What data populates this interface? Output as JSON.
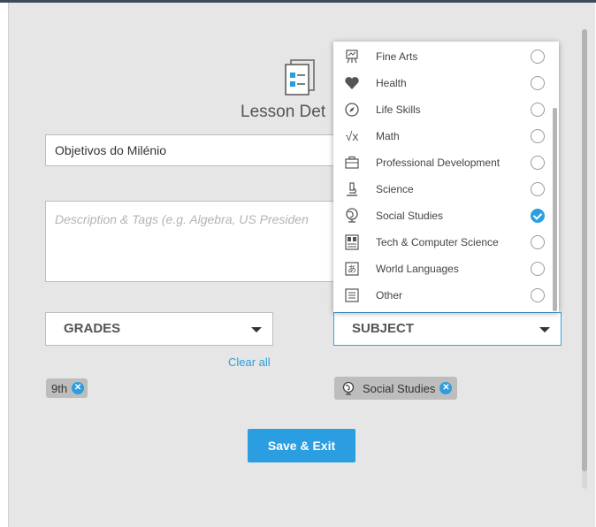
{
  "header": {
    "title": "Lesson Det"
  },
  "form": {
    "title_value": "Objetivos do Milénio",
    "description_placeholder": "Description & Tags (e.g. Algebra, US Presiden"
  },
  "grades": {
    "label": "GRADES",
    "clear_all": "Clear all",
    "selected": [
      "9th"
    ]
  },
  "subject": {
    "label": "SUBJECT",
    "selected_chip": "Social Studies",
    "options": [
      {
        "label": "Fine Arts",
        "icon": "easel-icon",
        "checked": false
      },
      {
        "label": "Health",
        "icon": "heart-icon",
        "checked": false
      },
      {
        "label": "Life Skills",
        "icon": "compass-icon",
        "checked": false
      },
      {
        "label": "Math",
        "icon": "square-root-icon",
        "checked": false
      },
      {
        "label": "Professional Development",
        "icon": "briefcase-icon",
        "checked": false
      },
      {
        "label": "Science",
        "icon": "microscope-icon",
        "checked": false
      },
      {
        "label": "Social Studies",
        "icon": "globe-icon",
        "checked": true
      },
      {
        "label": "Tech & Computer Science",
        "icon": "computer-icon",
        "checked": false
      },
      {
        "label": "World Languages",
        "icon": "language-icon",
        "checked": false
      },
      {
        "label": "Other",
        "icon": "document-icon",
        "checked": false
      }
    ]
  },
  "actions": {
    "save_label": "Save & Exit"
  },
  "colors": {
    "accent": "#2a9ee0",
    "panel_bg": "#e6e6e6"
  }
}
